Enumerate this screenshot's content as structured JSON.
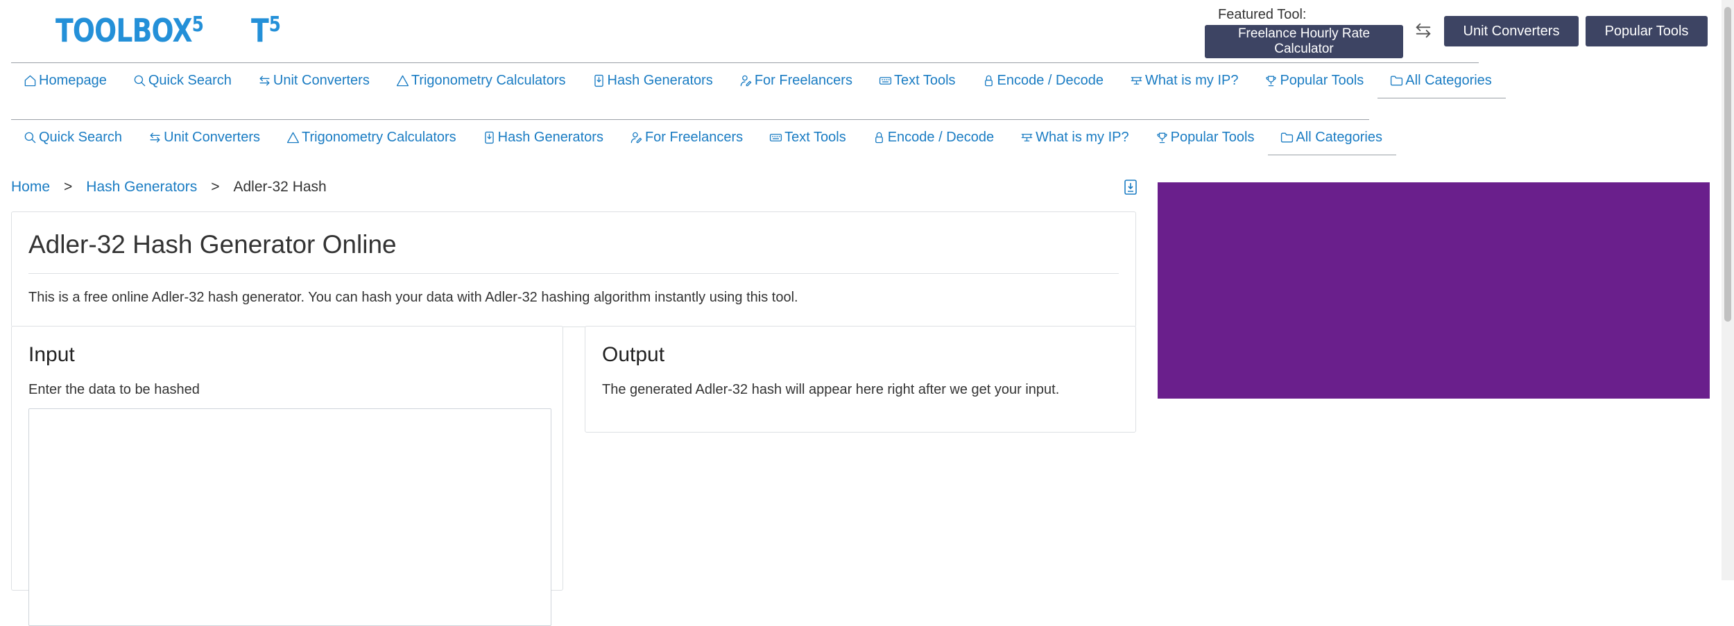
{
  "header": {
    "logo_text": "TOOLBOX",
    "logo_sup": "5",
    "logo_small_text": "T",
    "logo_small_sup": "5",
    "featured_label": "Featured Tool:",
    "featured_button": "Freelance Hourly Rate Calculator",
    "unit_converters_button": "Unit Converters",
    "popular_tools_button": "Popular Tools"
  },
  "nav_primary": [
    {
      "label": "Homepage",
      "icon": "home-icon"
    },
    {
      "label": "Quick Search",
      "icon": "search-icon"
    },
    {
      "label": "Unit Converters",
      "icon": "swap-icon"
    },
    {
      "label": "Trigonometry Calculators",
      "icon": "triangle-icon"
    },
    {
      "label": "Hash Generators",
      "icon": "hash-file-icon"
    },
    {
      "label": "For Freelancers",
      "icon": "user-edit-icon"
    },
    {
      "label": "Text Tools",
      "icon": "keyboard-icon"
    },
    {
      "label": "Encode / Decode",
      "icon": "lock-icon"
    },
    {
      "label": "What is my IP?",
      "icon": "network-icon"
    },
    {
      "label": "Popular Tools",
      "icon": "trophy-icon"
    },
    {
      "label": "All Categories",
      "icon": "folder-icon"
    }
  ],
  "nav_secondary": [
    {
      "label": "Quick Search",
      "icon": "search-icon"
    },
    {
      "label": "Unit Converters",
      "icon": "swap-icon"
    },
    {
      "label": "Trigonometry Calculators",
      "icon": "triangle-icon"
    },
    {
      "label": "Hash Generators",
      "icon": "hash-file-icon"
    },
    {
      "label": "For Freelancers",
      "icon": "user-edit-icon"
    },
    {
      "label": "Text Tools",
      "icon": "keyboard-icon"
    },
    {
      "label": "Encode / Decode",
      "icon": "lock-icon"
    },
    {
      "label": "What is my IP?",
      "icon": "network-icon"
    },
    {
      "label": "Popular Tools",
      "icon": "trophy-icon"
    },
    {
      "label": "All Categories",
      "icon": "folder-icon"
    }
  ],
  "breadcrumb": {
    "home": "Home",
    "category": "Hash Generators",
    "current": "Adler-32 Hash",
    "separator": ">"
  },
  "page": {
    "title": "Adler-32 Hash Generator Online",
    "description": "This is a free online Adler-32 hash generator. You can hash your data with Adler-32 hashing algorithm instantly using this tool."
  },
  "input_panel": {
    "heading": "Input",
    "hint": "Enter the data to be hashed",
    "value": ""
  },
  "output_panel": {
    "heading": "Output",
    "hint": "The generated Adler-32 hash will appear here right after we get your input."
  },
  "colors": {
    "link": "#1a7cc3",
    "logo": "#2490d8",
    "button_bg": "#3d4463",
    "ad_block": "#6a1f8c"
  }
}
